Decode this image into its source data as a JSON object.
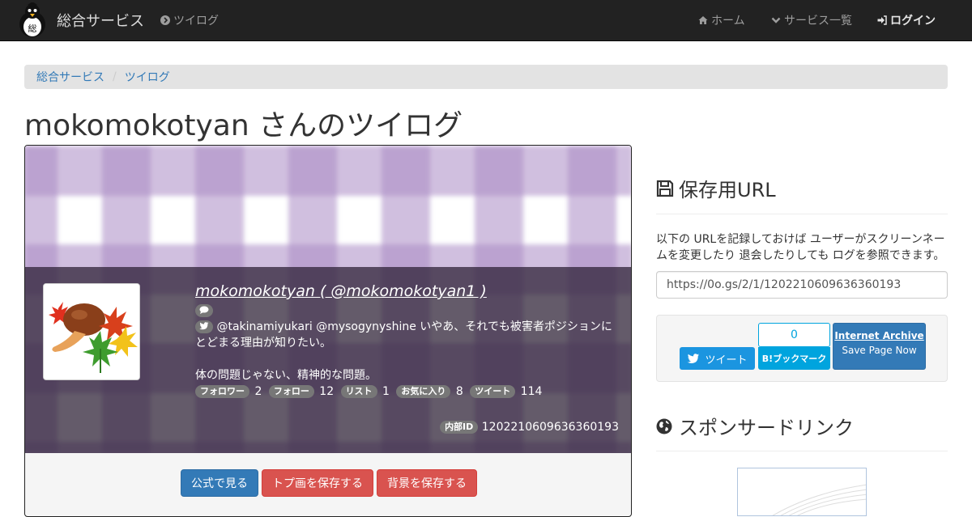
{
  "navbar": {
    "brand": "総合サービス",
    "links": [
      {
        "label": "ツイログ",
        "icon": "chevron-circle-right-icon"
      },
      {
        "label": "ホーム",
        "icon": "home-icon"
      },
      {
        "label": "サービス一覧",
        "icon": "chevron-down-icon"
      },
      {
        "label": "ログイン",
        "icon": "sign-in-icon"
      }
    ]
  },
  "breadcrumb": [
    "総合サービス",
    "ツイログ"
  ],
  "page_title": "mokomokotyan さんのツイログ",
  "profile": {
    "display_name": "mokomokotyan ( @mokomokotyan1 )",
    "bio_line1": "@takinamiyukari @mysogynyshine いやあ、それでも被害者ポジションにとどまる理由が知りたい。",
    "bio_line2": "体の問題じゃない、精神的な問題。",
    "stats": [
      {
        "label": "フォロワー",
        "value": "2"
      },
      {
        "label": "フォロー",
        "value": "12"
      },
      {
        "label": "リスト",
        "value": "1"
      },
      {
        "label": "お気に入り",
        "value": "8"
      },
      {
        "label": "ツイート",
        "value": "114"
      }
    ],
    "internal_id_label": "内部ID",
    "internal_id": "1202210609636360193",
    "banner_color": "#a98bc4"
  },
  "actions": {
    "official": "公式で見る",
    "save_top": "トプ画を保存する",
    "save_bg": "背景を保存する"
  },
  "sidebar": {
    "save_heading": "保存用URL",
    "description": "以下の URLを記録しておけば ユーザーがスクリーンネームを変更したり 退会したりしても ログを参照できます。",
    "url": "https://0o.gs/2/1/1202210609636360193",
    "tweet_label": "ツイート",
    "hatena_count": "0",
    "hatena_label": "B!ブックマーク",
    "ia_title": "Internet Archive",
    "ia_sub": "Save Page Now",
    "sponsored_heading": "スポンサードリンク"
  }
}
